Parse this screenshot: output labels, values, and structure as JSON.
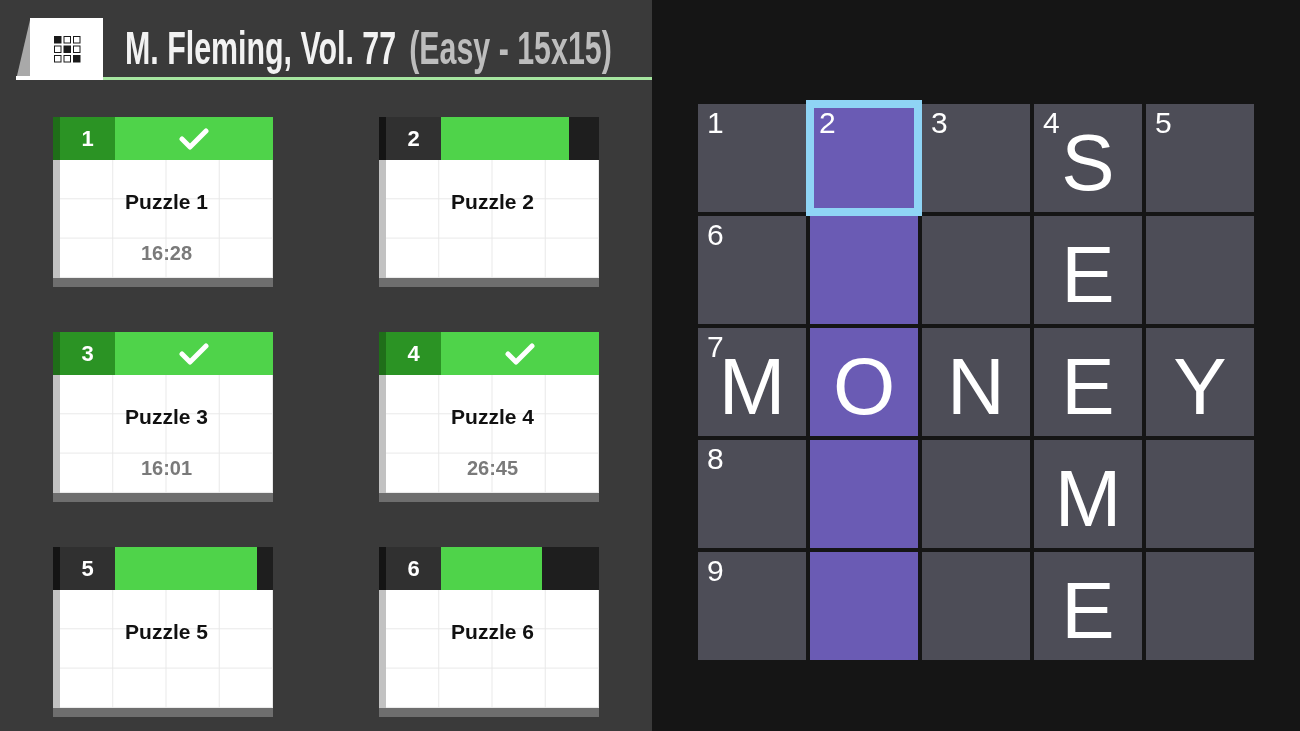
{
  "header": {
    "title": "M. Fleming, Vol. 77",
    "subtitle": "(Easy - 15x15)"
  },
  "puzzles": [
    {
      "number": "1",
      "title": "Puzzle 1",
      "time": "16:28",
      "completed": true,
      "level": 1
    },
    {
      "number": "2",
      "title": "Puzzle 2",
      "completed": false,
      "level": 0.81
    },
    {
      "number": "3",
      "title": "Puzzle 3",
      "time": "16:01",
      "completed": true,
      "level": 1
    },
    {
      "number": "4",
      "title": "Puzzle 4",
      "time": "26:45",
      "completed": true,
      "level": 1
    },
    {
      "number": "5",
      "title": "Puzzle 5",
      "completed": false,
      "level": 0.9
    },
    {
      "number": "6",
      "title": "Puzzle 6",
      "completed": false,
      "level": 0.64
    }
  ],
  "grid": {
    "rows": [
      [
        {
          "number": "1",
          "highlighted": false,
          "selected": false
        },
        {
          "number": "2",
          "highlighted": true,
          "selected": true
        },
        {
          "number": "3",
          "highlighted": false,
          "selected": false
        },
        {
          "number": "4",
          "letter": "S",
          "highlighted": false,
          "selected": false
        },
        {
          "number": "5",
          "highlighted": false,
          "selected": false
        }
      ],
      [
        {
          "number": "6",
          "highlighted": false,
          "selected": false
        },
        {
          "highlighted": true,
          "selected": false
        },
        {
          "highlighted": false,
          "selected": false
        },
        {
          "letter": "E",
          "highlighted": false,
          "selected": false
        },
        {
          "highlighted": false,
          "selected": false
        }
      ],
      [
        {
          "number": "7",
          "letter": "M",
          "highlighted": false,
          "selected": false
        },
        {
          "letter": "O",
          "highlighted": true,
          "selected": false
        },
        {
          "letter": "N",
          "highlighted": false,
          "selected": false
        },
        {
          "letter": "E",
          "highlighted": false,
          "selected": false
        },
        {
          "letter": "Y",
          "highlighted": false,
          "selected": false
        }
      ],
      [
        {
          "number": "8",
          "highlighted": false,
          "selected": false
        },
        {
          "highlighted": true,
          "selected": false
        },
        {
          "highlighted": false,
          "selected": false
        },
        {
          "letter": "M",
          "highlighted": false,
          "selected": false
        },
        {
          "highlighted": false,
          "selected": false
        }
      ],
      [
        {
          "number": "9",
          "highlighted": false,
          "selected": false
        },
        {
          "highlighted": true,
          "selected": false
        },
        {
          "highlighted": false,
          "selected": false
        },
        {
          "letter": "E",
          "highlighted": false,
          "selected": false
        },
        {
          "highlighted": false,
          "selected": false
        }
      ]
    ]
  }
}
